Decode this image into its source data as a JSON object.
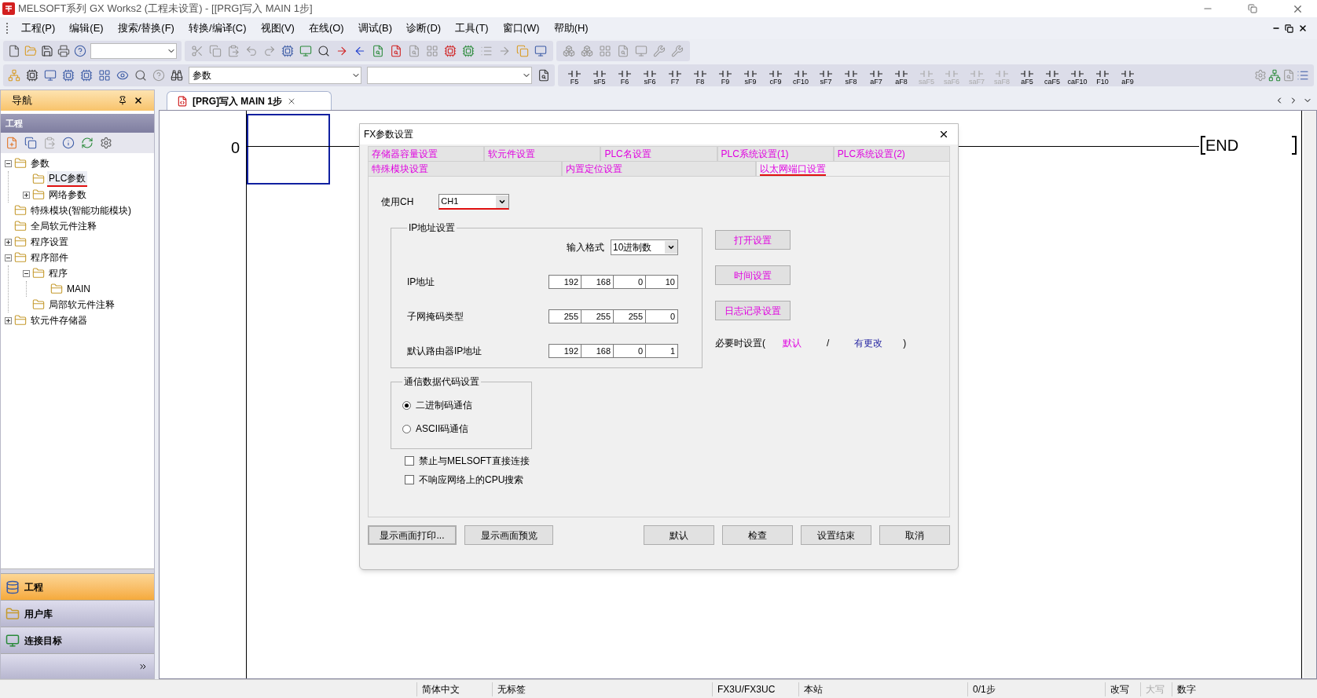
{
  "window": {
    "title": "MELSOFT系列 GX Works2 (工程未设置) - [[PRG]写入 MAIN 1步]"
  },
  "menu": [
    "工程(P)",
    "编辑(E)",
    "搜索/替换(F)",
    "转换/编译(C)",
    "视图(V)",
    "在线(O)",
    "调试(B)",
    "诊断(D)",
    "工具(T)",
    "窗口(W)",
    "帮助(H)"
  ],
  "toolbar": {
    "search_value": "参数"
  },
  "ladder_keys": [
    {
      "label": "F5",
      "disabled": false
    },
    {
      "label": "sF5",
      "disabled": false
    },
    {
      "label": "F6",
      "disabled": false
    },
    {
      "label": "sF6",
      "disabled": false
    },
    {
      "label": "F7",
      "disabled": false
    },
    {
      "label": "F8",
      "disabled": false
    },
    {
      "label": "F9",
      "disabled": false
    },
    {
      "label": "sF9",
      "disabled": false
    },
    {
      "label": "cF9",
      "disabled": false
    },
    {
      "label": "cF10",
      "disabled": false
    },
    {
      "label": "sF7",
      "disabled": false
    },
    {
      "label": "sF8",
      "disabled": false
    },
    {
      "label": "aF7",
      "disabled": false
    },
    {
      "label": "aF8",
      "disabled": false
    },
    {
      "label": "saF5",
      "disabled": true
    },
    {
      "label": "saF6",
      "disabled": true
    },
    {
      "label": "saF7",
      "disabled": true
    },
    {
      "label": "saF8",
      "disabled": true
    },
    {
      "label": "aF5",
      "disabled": false
    },
    {
      "label": "caF5",
      "disabled": false
    },
    {
      "label": "caF10",
      "disabled": false
    },
    {
      "label": "F10",
      "disabled": false
    },
    {
      "label": "aF9",
      "disabled": false
    }
  ],
  "navigation": {
    "title": "导航",
    "section": "工程",
    "tree": [
      {
        "label": "参数",
        "expanded": true,
        "children": [
          {
            "label": "PLC参数",
            "selected": true,
            "annotated": true
          },
          {
            "label": "网络参数",
            "expanded": false,
            "selected": false,
            "annotated": false
          }
        ],
        "selected": false,
        "annotated": false
      },
      {
        "label": "特殊模块(智能功能模块)",
        "selected": false,
        "annotated": false
      },
      {
        "label": "全局软元件注释",
        "selected": false,
        "annotated": false
      },
      {
        "label": "程序设置",
        "expanded": false,
        "selected": false,
        "annotated": false
      },
      {
        "label": "程序部件",
        "expanded": true,
        "selected": false,
        "annotated": false,
        "children": [
          {
            "label": "程序",
            "expanded": true,
            "selected": false,
            "annotated": false,
            "children": [
              {
                "label": "MAIN",
                "selected": false,
                "annotated": false
              }
            ]
          },
          {
            "label": "局部软元件注释",
            "selected": false,
            "annotated": false
          }
        ]
      },
      {
        "label": "软元件存储器",
        "expanded": false,
        "selected": false,
        "annotated": false
      }
    ],
    "bottom_tabs": [
      {
        "label": "工程",
        "selected": true
      },
      {
        "label": "用户库",
        "selected": false
      },
      {
        "label": "连接目标",
        "selected": false
      }
    ]
  },
  "editor_tab": {
    "title": "[PRG]写入 MAIN 1步"
  },
  "ladder": {
    "step": "0",
    "end": "END"
  },
  "dialog": {
    "title": "FX参数设置",
    "tab_rows": [
      [
        {
          "label": "存储器容量设置",
          "selected": false,
          "annotated": false
        },
        {
          "label": "软元件设置",
          "selected": false,
          "annotated": false
        },
        {
          "label": "PLC名设置",
          "selected": false,
          "annotated": false
        },
        {
          "label": "PLC系统设置(1)",
          "selected": false,
          "annotated": false
        },
        {
          "label": "PLC系统设置(2)",
          "selected": false,
          "annotated": false
        }
      ],
      [
        {
          "label": "特殊模块设置",
          "selected": false,
          "annotated": false
        },
        {
          "label": "内置定位设置",
          "selected": false,
          "annotated": false
        },
        {
          "label": "以太网端口设置",
          "selected": true,
          "annotated": true
        }
      ]
    ],
    "channel": {
      "label": "使用CH",
      "value": "CH1",
      "annotated": true
    },
    "ip_group": {
      "title": "IP地址设置",
      "format_label": "输入格式",
      "format_value": "10进制数",
      "rows": [
        {
          "label": "IP地址",
          "octets": [
            "192",
            "168",
            "0",
            "10"
          ]
        },
        {
          "label": "子网掩码类型",
          "octets": [
            "255",
            "255",
            "255",
            "0"
          ]
        },
        {
          "label": "默认路由器IP地址",
          "octets": [
            "192",
            "168",
            "0",
            "1"
          ]
        }
      ]
    },
    "side_buttons": [
      "打开设置",
      "时间设置",
      "日志记录设置"
    ],
    "legend": {
      "prefix": "必要时设置(",
      "default": "默认",
      "separator": "/",
      "changed": "有更改",
      "suffix": ")"
    },
    "code_group": {
      "title": "通信数据代码设置",
      "options": [
        {
          "label": "二进制码通信",
          "selected": true
        },
        {
          "label": "ASCII码通信",
          "selected": false
        }
      ]
    },
    "checkboxes": [
      {
        "label": "禁止与MELSOFT直接连接",
        "checked": false
      },
      {
        "label": "不响应网络上的CPU搜索",
        "checked": false
      }
    ],
    "left_buttons": [
      "显示画面打印...",
      "显示画面预览"
    ],
    "right_buttons": [
      "默认",
      "检查",
      "设置结束",
      "取消"
    ]
  },
  "status_bar": [
    {
      "text": "简体中文",
      "disabled": false
    },
    {
      "text": "无标签",
      "disabled": false
    },
    {
      "text": "FX3U/FX3UC",
      "disabled": false
    },
    {
      "text": "本站",
      "disabled": false
    },
    {
      "text": "0/1步",
      "disabled": false
    },
    {
      "text": "改写",
      "disabled": false
    },
    {
      "text": "大写",
      "disabled": true
    },
    {
      "text": "数字",
      "disabled": false
    }
  ]
}
